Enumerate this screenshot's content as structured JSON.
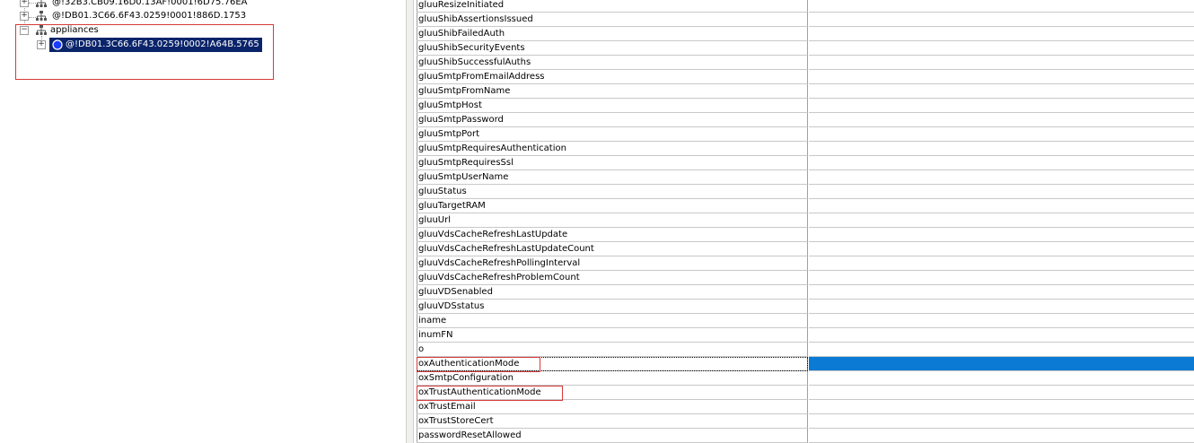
{
  "tree": {
    "nodes": [
      {
        "label": "@!32B3.CB09.16D0.13AF!0001!6D75.76EA",
        "expanded": false
      },
      {
        "label": "@!DB01.3C66.6F43.0259!0001!886D.1753",
        "expanded": false
      },
      {
        "label": "appliances",
        "expanded": true
      },
      {
        "label": "@!DB01.3C66.6F43.0259!0002!A64B.5765",
        "expanded": false,
        "selected": true
      }
    ]
  },
  "grid": {
    "selected_color": "#0a7ad4",
    "rows": [
      {
        "name": "gluuResizeInitiated",
        "value": ""
      },
      {
        "name": "gluuShibAssertionsIssued",
        "value": ""
      },
      {
        "name": "gluuShibFailedAuth",
        "value": ""
      },
      {
        "name": "gluuShibSecurityEvents",
        "value": ""
      },
      {
        "name": "gluuShibSuccessfulAuths",
        "value": ""
      },
      {
        "name": "gluuSmtpFromEmailAddress",
        "value": ""
      },
      {
        "name": "gluuSmtpFromName",
        "value": ""
      },
      {
        "name": "gluuSmtpHost",
        "value": ""
      },
      {
        "name": "gluuSmtpPassword",
        "value": ""
      },
      {
        "name": "gluuSmtpPort",
        "value": ""
      },
      {
        "name": "gluuSmtpRequiresAuthentication",
        "value": ""
      },
      {
        "name": "gluuSmtpRequiresSsl",
        "value": ""
      },
      {
        "name": "gluuSmtpUserName",
        "value": ""
      },
      {
        "name": "gluuStatus",
        "value": ""
      },
      {
        "name": "gluuTargetRAM",
        "value": ""
      },
      {
        "name": "gluuUrl",
        "value": ""
      },
      {
        "name": "gluuVdsCacheRefreshLastUpdate",
        "value": ""
      },
      {
        "name": "gluuVdsCacheRefreshLastUpdateCount",
        "value": ""
      },
      {
        "name": "gluuVdsCacheRefreshPollingInterval",
        "value": ""
      },
      {
        "name": "gluuVdsCacheRefreshProblemCount",
        "value": ""
      },
      {
        "name": "gluuVDSenabled",
        "value": ""
      },
      {
        "name": "gluuVDSstatus",
        "value": ""
      },
      {
        "name": "iname",
        "value": ""
      },
      {
        "name": "inumFN",
        "value": ""
      },
      {
        "name": "o",
        "value": ""
      },
      {
        "name": "oxAuthenticationMode",
        "value": "",
        "selected": true,
        "boxed": true
      },
      {
        "name": "oxSmtpConfiguration",
        "value": ""
      },
      {
        "name": "oxTrustAuthenticationMode",
        "value": "",
        "boxed": true
      },
      {
        "name": "oxTrustEmail",
        "value": ""
      },
      {
        "name": "oxTrustStoreCert",
        "value": ""
      },
      {
        "name": "passwordResetAllowed",
        "value": ""
      }
    ]
  }
}
